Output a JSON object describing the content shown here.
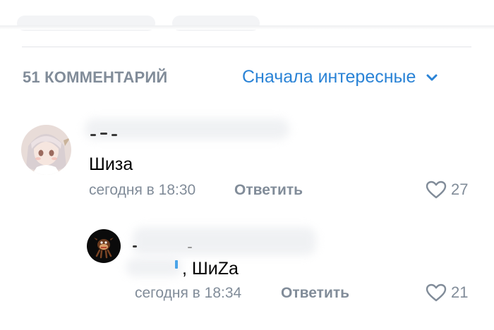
{
  "header": {
    "comment_count_label": "51 КОММЕНТАРИЙ",
    "sort_label": "Сначала интересные",
    "sort_icon": "chevron-down-icon"
  },
  "comments": [
    {
      "text": "Шиза",
      "time": "сегодня в 18:30",
      "reply_label": "Ответить",
      "likes": "27",
      "avatar": "anime-girl-avatar",
      "like_icon": "heart-outline-icon"
    },
    {
      "text": ", ШиZa",
      "time": "сегодня в 18:34",
      "reply_label": "Ответить",
      "likes": "21",
      "avatar": "tasmanian-devil-avatar",
      "like_icon": "heart-outline-icon"
    }
  ],
  "colors": {
    "accent": "#2a83d6",
    "secondary_text": "#818c99",
    "divider": "#e3e4e8"
  }
}
